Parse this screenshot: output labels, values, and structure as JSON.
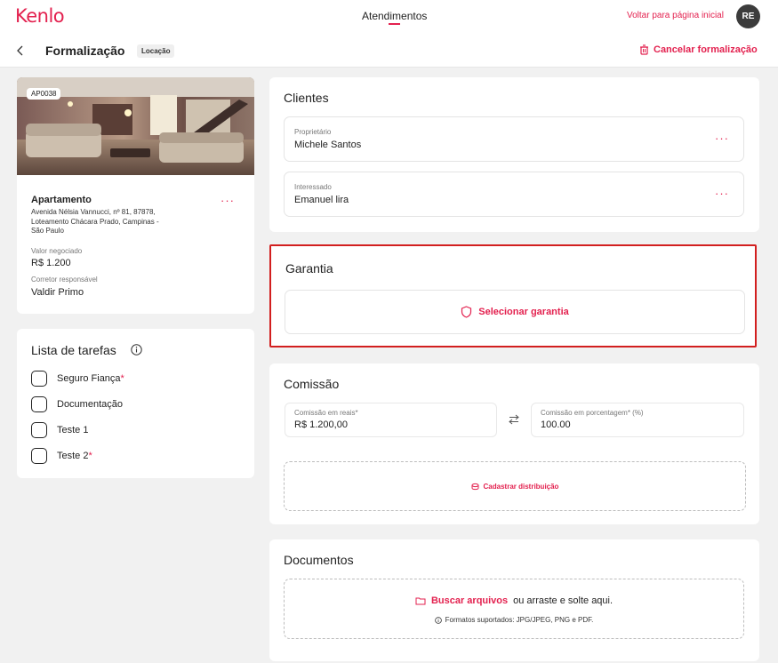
{
  "header": {
    "logo": "Kenlo",
    "nav_center": "Atendimentos",
    "back_home": "Voltar para página inicial",
    "avatar_initials": "RE"
  },
  "subheader": {
    "title": "Formalização",
    "tag": "Locação",
    "cancel": "Cancelar formalização"
  },
  "property": {
    "code": "AP0038",
    "type": "Apartamento",
    "address": "Avenida Nélsia Vannucci, nº 81, 87878, Loteamento Chácara Prado, Campinas - São Paulo",
    "valor_label": "Valor negociado",
    "valor": "R$ 1.200",
    "corretor_label": "Corretor responsável",
    "corretor": "Valdir Primo",
    "more": "···"
  },
  "tasks": {
    "title": "Lista de tarefas",
    "items": [
      {
        "label": "Seguro Fiança",
        "required": "*"
      },
      {
        "label": "Documentação",
        "required": ""
      },
      {
        "label": "Teste 1",
        "required": ""
      },
      {
        "label": "Teste 2",
        "required": "*"
      }
    ]
  },
  "clients": {
    "title": "Clientes",
    "items": [
      {
        "label": "Proprietário",
        "name": "Michele Santos",
        "more": "···"
      },
      {
        "label": "Interessado",
        "name": "Emanuel lira",
        "more": "···"
      }
    ]
  },
  "garantia": {
    "title": "Garantia",
    "select": "Selecionar garantia"
  },
  "comissao": {
    "title": "Comissão",
    "reais_label": "Comissão em reais*",
    "reais_value": "R$ 1.200,00",
    "pct_label": "Comissão em porcentagem* (%)",
    "pct_value": "100.00",
    "distribuicao": "Cadastrar distribuição"
  },
  "documentos": {
    "title": "Documentos",
    "buscar": "Buscar arquivos",
    "drop_text": "ou arraste e solte aqui.",
    "formats": "Formatos suportados: JPG/JPEG, PNG e PDF."
  },
  "colors": {
    "brand": "#e3214f",
    "highlight_border": "#d21f1f"
  }
}
